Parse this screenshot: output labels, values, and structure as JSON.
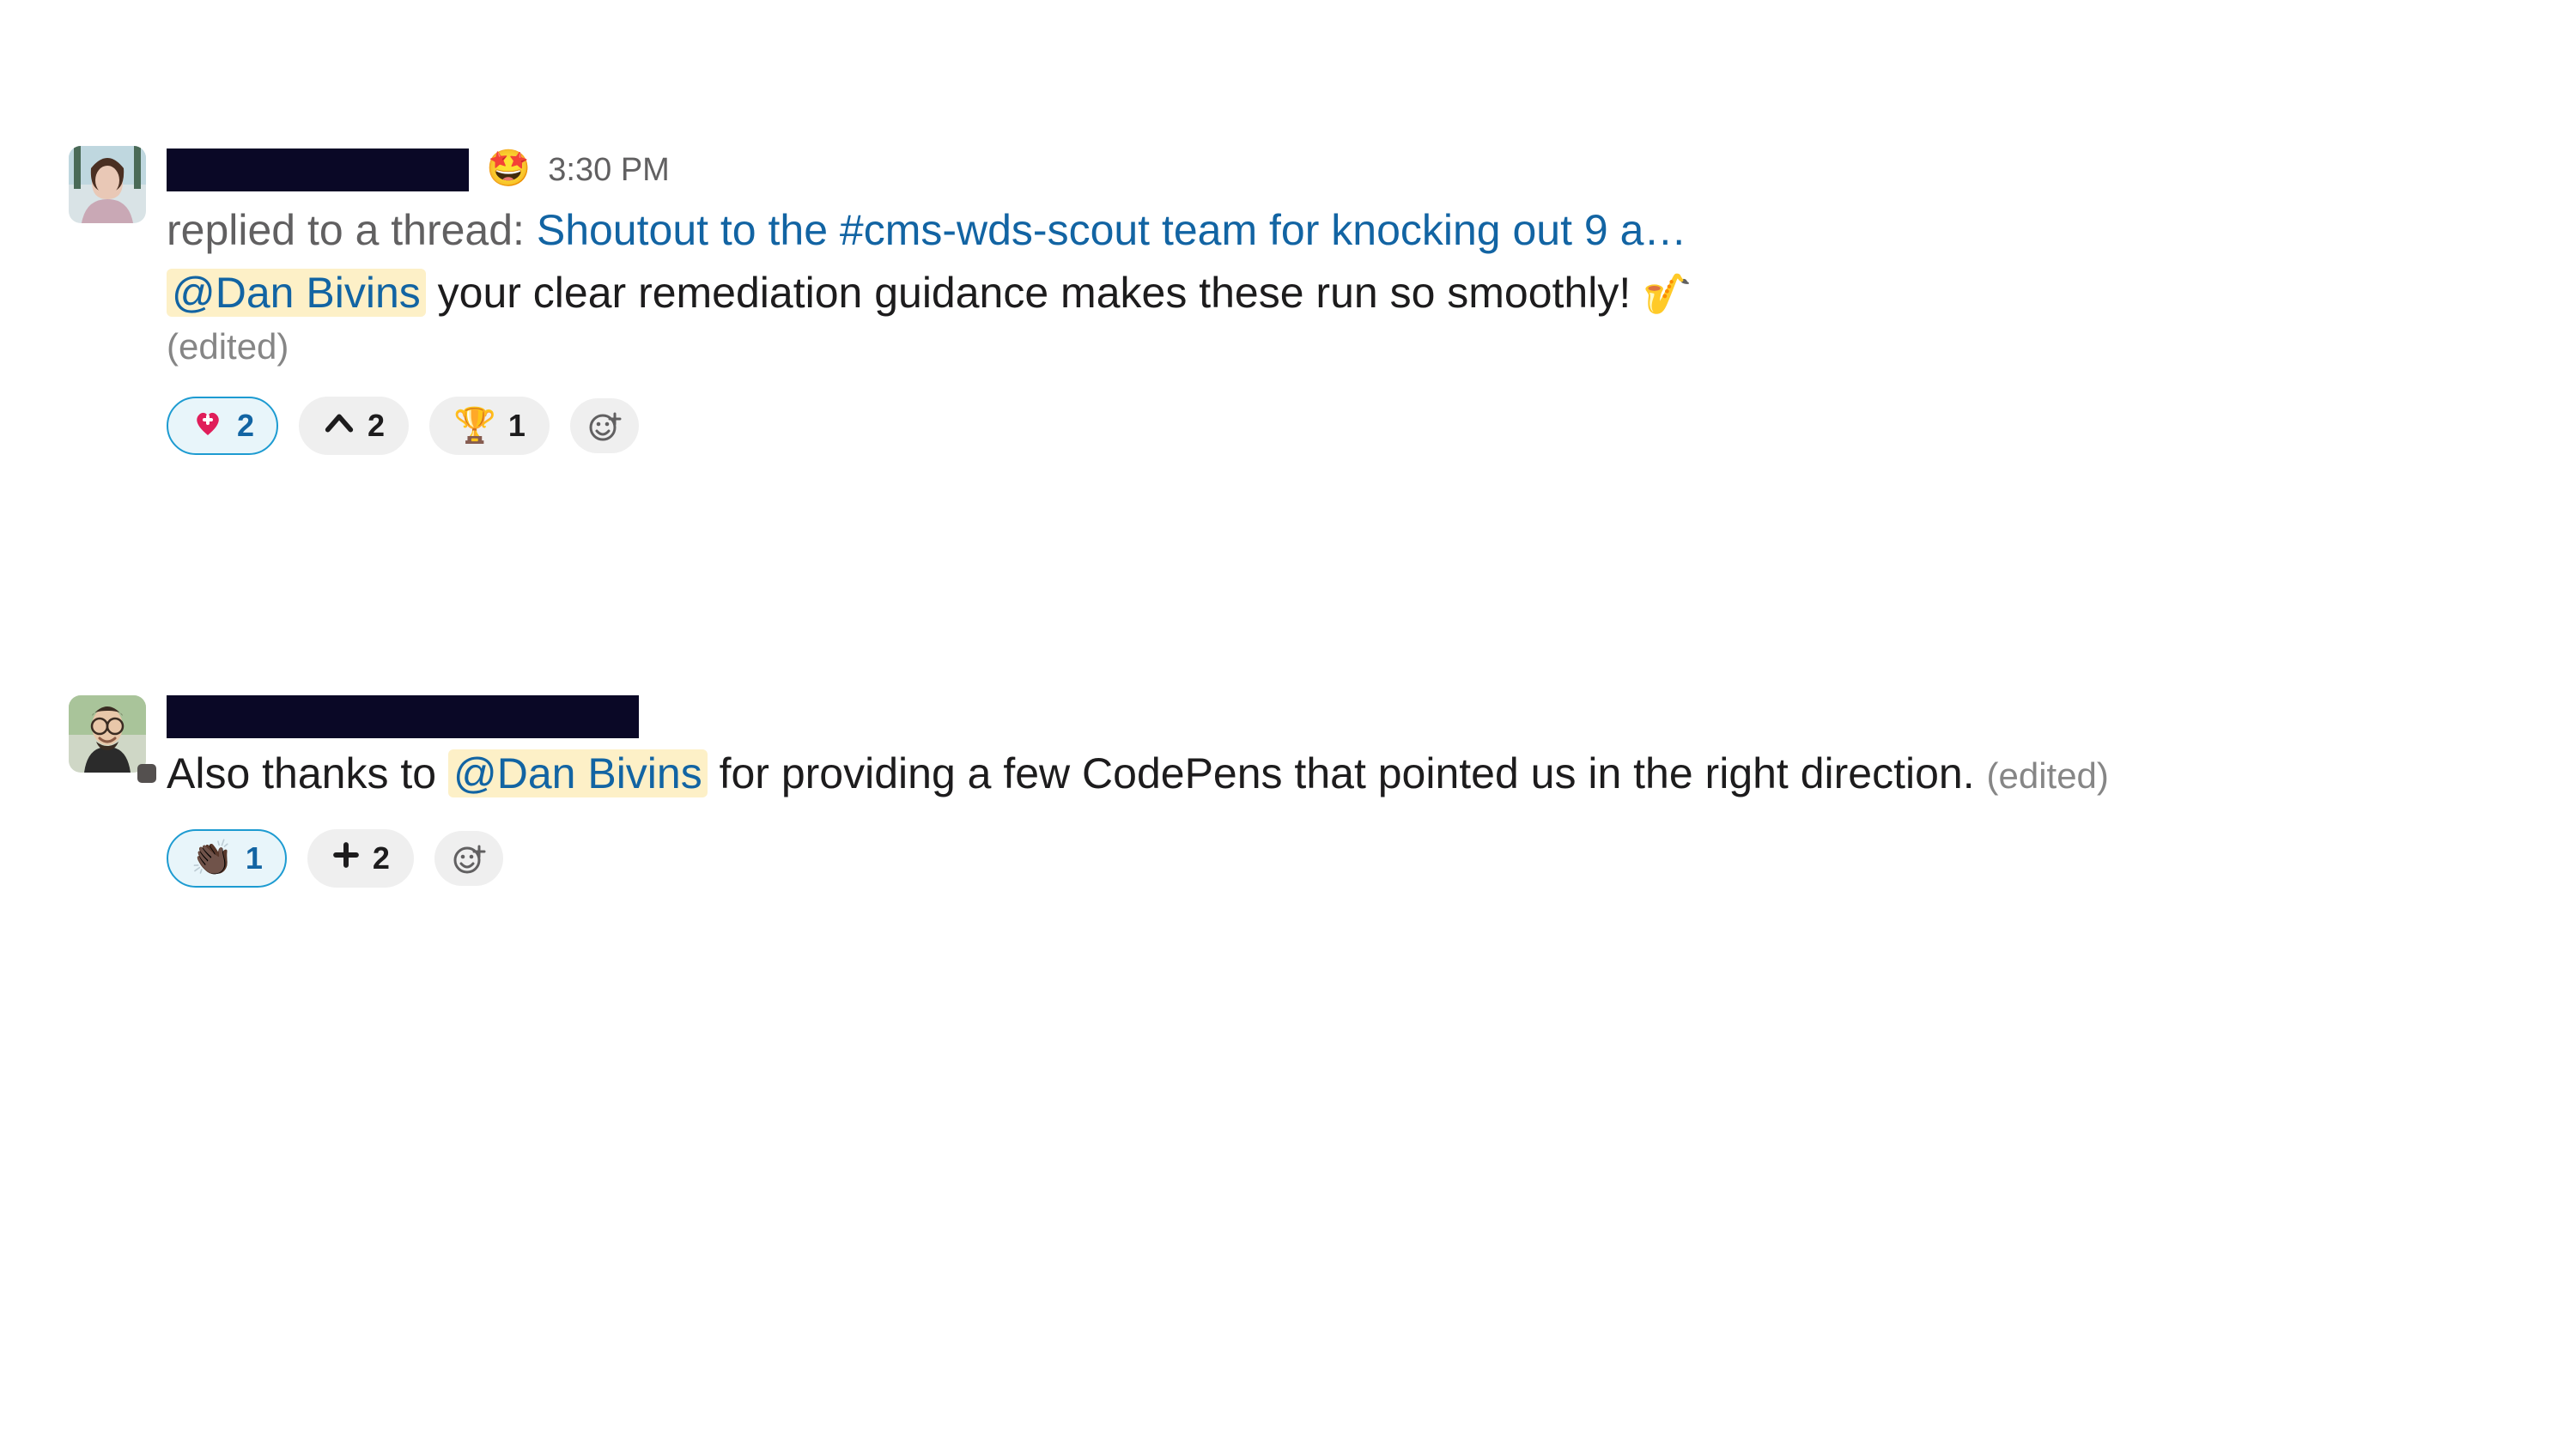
{
  "messages": [
    {
      "timestamp": "3:30 PM",
      "status_emoji": "🤩",
      "reply_prefix": "replied to a thread: ",
      "thread_title": "Shoutout to the #cms-wds-scout team for knocking out 9 a…",
      "mention": "@Dan Bivins",
      "body_after_mention": " your clear remediation guidance makes these run so smoothly! ",
      "trailing_emoji": "🎷",
      "edited": "(edited)",
      "reactions": [
        {
          "icon": "heart-plus",
          "glyph": "❤️",
          "count": 2,
          "selected": true
        },
        {
          "icon": "up-chevron",
          "glyph": "˄",
          "count": 2,
          "selected": false
        },
        {
          "icon": "trophy",
          "glyph": "🏆",
          "count": 1,
          "selected": false
        }
      ]
    },
    {
      "body_before_mention": "Also thanks to ",
      "mention": "@Dan Bivins",
      "body_after_mention": " for providing a few CodePens that pointed us in the right direction. ",
      "edited": "(edited)",
      "reactions": [
        {
          "icon": "clap-dark",
          "glyph": "👏🏿",
          "count": 1,
          "selected": true
        },
        {
          "icon": "plus",
          "glyph": "＋",
          "count": 2,
          "selected": false
        }
      ]
    }
  ]
}
